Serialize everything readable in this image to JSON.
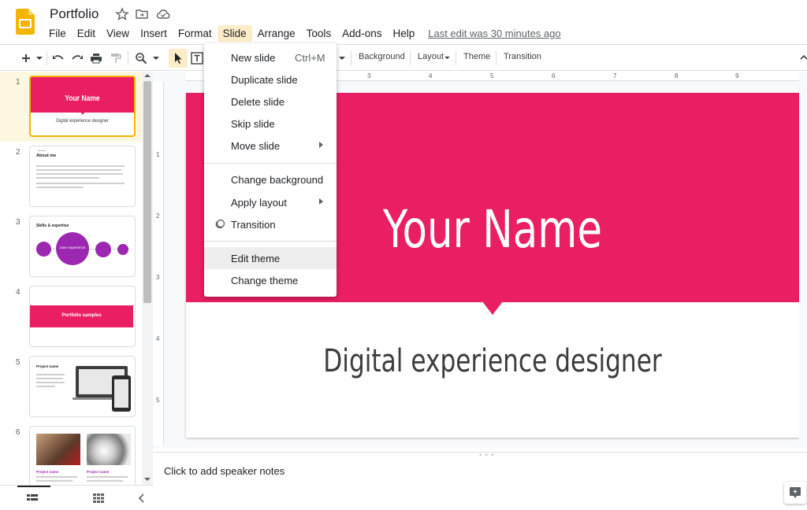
{
  "app": {
    "title": "Portfolio",
    "last_edit": "Last edit was 30 minutes ago"
  },
  "menubar": [
    "File",
    "Edit",
    "View",
    "Insert",
    "Format",
    "Slide",
    "Arrange",
    "Tools",
    "Add-ons",
    "Help"
  ],
  "toolbar": {
    "background_label": "Background",
    "layout_label": "Layout",
    "theme_label": "Theme",
    "transition_label": "Transition"
  },
  "ruler": {
    "h": [
      "3",
      "4",
      "5",
      "6",
      "7",
      "8",
      "9"
    ],
    "v": [
      "1",
      "2",
      "3",
      "4",
      "5"
    ]
  },
  "slide_menu": {
    "items": [
      {
        "label": "New slide",
        "shortcut": "Ctrl+M"
      },
      {
        "label": "Duplicate slide"
      },
      {
        "label": "Delete slide"
      },
      {
        "label": "Skip slide"
      },
      {
        "label": "Move slide",
        "submenu": true
      },
      {
        "label": "Change background"
      },
      {
        "label": "Apply layout",
        "submenu": true
      },
      {
        "label": "Transition",
        "icon": "transition-icon"
      },
      {
        "label": "Edit theme"
      },
      {
        "label": "Change theme"
      }
    ]
  },
  "slides": [
    {
      "number": "1",
      "title": "Your Name",
      "subtitle": "Digital experience designer"
    },
    {
      "number": "2",
      "title": "About me"
    },
    {
      "number": "3",
      "title": "Skills & expertise",
      "center": "User experience"
    },
    {
      "number": "4",
      "title": "Portfolio samples"
    },
    {
      "number": "5",
      "title": "Project name"
    },
    {
      "number": "6",
      "left": "Project name",
      "right": "Project name"
    }
  ],
  "main_slide": {
    "title": "Your Name",
    "subtitle": "Digital experience designer"
  },
  "notes": {
    "placeholder": "Click to add speaker notes"
  },
  "colors": {
    "accent": "#e91e63",
    "purple": "#9c27b0",
    "selection": "#f4b400",
    "menu_active": "#fdecc8"
  }
}
